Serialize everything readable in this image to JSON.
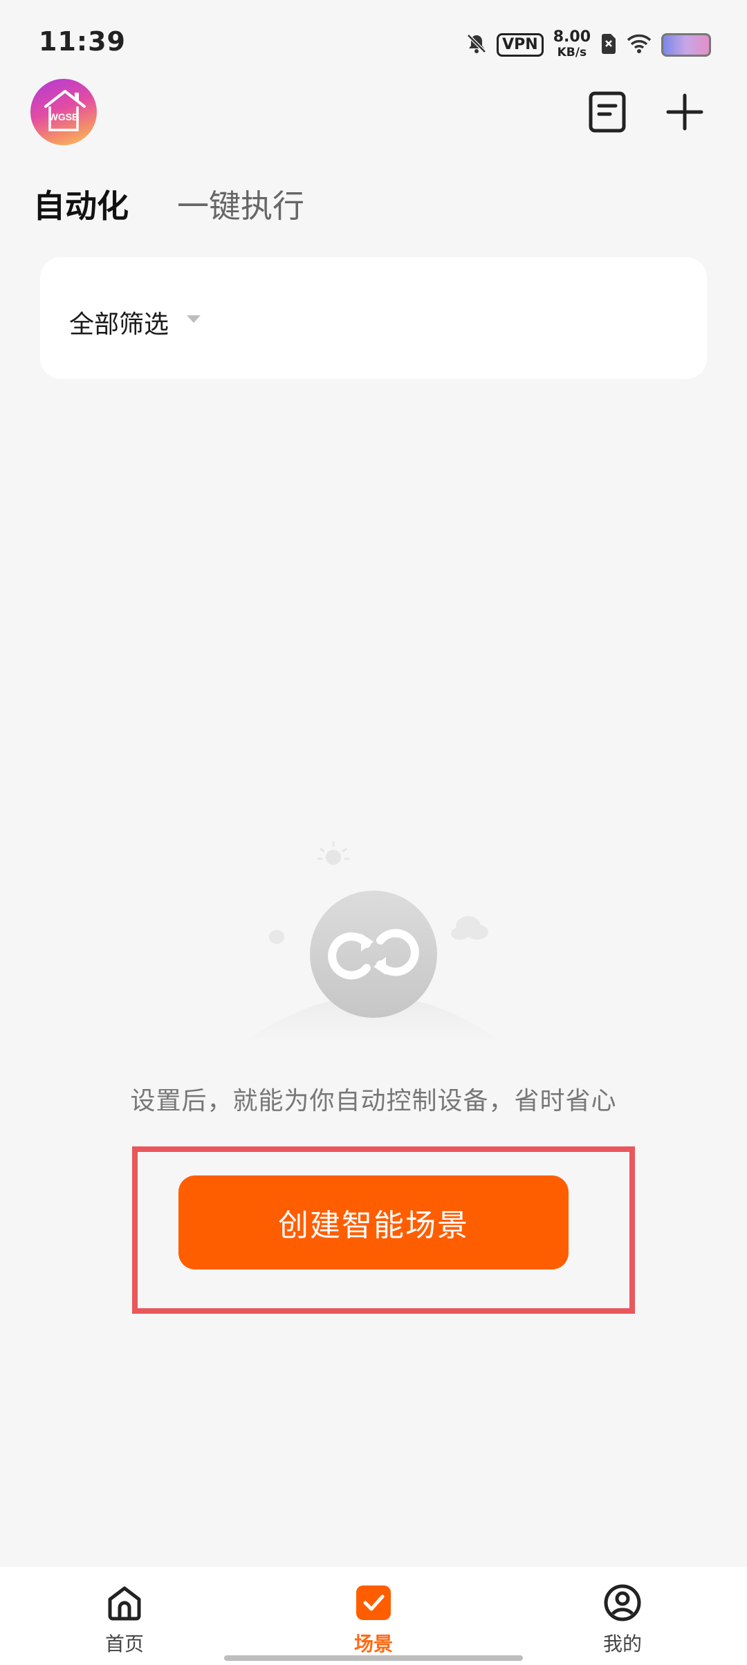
{
  "status_bar": {
    "time": "11:39",
    "vpn": "VPN",
    "speed_value": "8.00",
    "speed_unit": "KB/s",
    "icons": [
      "mute-bell-icon",
      "vpn-icon",
      "network-speed",
      "sim-off-icon",
      "wifi-icon",
      "battery-icon"
    ]
  },
  "header": {
    "avatar_text": "WGSE",
    "icons": [
      "notes-icon",
      "add-icon"
    ]
  },
  "tabs": [
    {
      "label": "自动化",
      "active": true
    },
    {
      "label": "一键执行",
      "active": false
    }
  ],
  "filter": {
    "label": "全部筛选"
  },
  "empty_state": {
    "message": "设置后，就能为你自动控制设备，省时省心",
    "button_label": "创建智能场景"
  },
  "bottom_nav": [
    {
      "label": "首页",
      "icon": "home-icon",
      "active": false
    },
    {
      "label": "场景",
      "icon": "scene-check-icon",
      "active": true
    },
    {
      "label": "我的",
      "icon": "profile-icon",
      "active": false
    }
  ],
  "colors": {
    "accent": "#ff5e00",
    "active_tab_label": "#ff6a13",
    "highlight_border": "#e8575c",
    "background": "#f6f6f6"
  }
}
